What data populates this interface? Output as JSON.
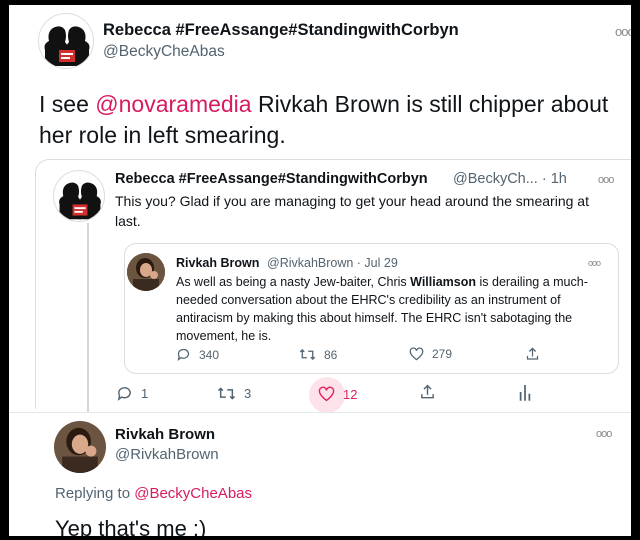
{
  "tweet": {
    "author_name": "Rebecca #FreeAssange#StandingwithCorbyn",
    "author_handle": "@BeckyCheAbas",
    "text_prefix": "I see ",
    "text_mention": "@novaramedia",
    "text_suffix": " Rivkah Brown is still chipper about her role in left smearing."
  },
  "quoted_thread": {
    "author_name": "Rebecca #FreeAssange#StandingwithCorbyn",
    "author_handle_time": "@BeckyCh... · 1h",
    "text": "This you? Glad if you are managing to get your head around the smearing at last.",
    "inner": {
      "author_name": "Rivkah Brown",
      "author_handle_date": "@RivkahBrown · Jul 29",
      "text_before": "As well as being a nasty Jew-baiter, Chris ",
      "text_bold": "Williamson",
      "text_after": " is derailing a much-needed conversation about the EHRC's credibility as an instrument of antiracism by making this about himself. The EHRC isn't sabotaging the movement, he is.",
      "replies": "340",
      "retweets": "86",
      "likes": "279"
    },
    "replies": "1",
    "retweets": "3",
    "likes": "12",
    "colors": {
      "like_active": "#e0245e",
      "mention": "#d81b60"
    }
  },
  "reply": {
    "author_name": "Rivkah Brown",
    "author_handle": "@RivkahBrown",
    "replying_to_prefix": "Replying to ",
    "replying_to_handle": "@BeckyCheAbas",
    "text": "Yep that's me :)"
  },
  "icons": [
    "more-icon",
    "reply-icon",
    "retweet-icon",
    "heart-icon",
    "share-icon",
    "analytics-icon"
  ]
}
